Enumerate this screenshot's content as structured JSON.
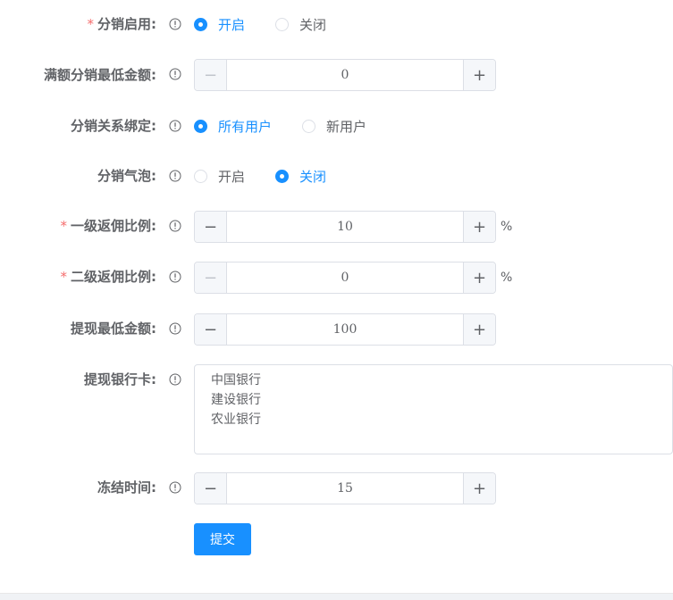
{
  "form": {
    "fields": [
      {
        "label": "分销启用:",
        "required": true,
        "type": "radio",
        "options": [
          "开启",
          "关闭"
        ],
        "selected": 0
      },
      {
        "label": "满额分销最低金额:",
        "required": false,
        "type": "stepper",
        "value": "0"
      },
      {
        "label": "分销关系绑定:",
        "required": false,
        "type": "radio",
        "options": [
          "所有用户",
          "新用户"
        ],
        "selected": 0
      },
      {
        "label": "分销气泡:",
        "required": false,
        "type": "radio",
        "options": [
          "开启",
          "关闭"
        ],
        "selected": 1
      },
      {
        "label": "一级返佣比例:",
        "required": true,
        "type": "stepper",
        "value": "10",
        "unit": "%"
      },
      {
        "label": "二级返佣比例:",
        "required": true,
        "type": "stepper",
        "value": "0",
        "unit": "%"
      },
      {
        "label": "提现最低金额:",
        "required": false,
        "type": "stepper",
        "value": "100"
      },
      {
        "label": "提现银行卡:",
        "required": false,
        "type": "textarea",
        "value": "中国银行\n建设银行\n农业银行"
      },
      {
        "label": "冻结时间:",
        "required": false,
        "type": "stepper",
        "value": "15"
      }
    ],
    "required_mark": "*",
    "minus_symbol": "−",
    "plus_symbol": "+",
    "submit_label": "提交"
  },
  "colors": {
    "primary": "#1890ff",
    "required": "#f56c6c",
    "text": "#606266",
    "border": "#dcdfe6"
  }
}
